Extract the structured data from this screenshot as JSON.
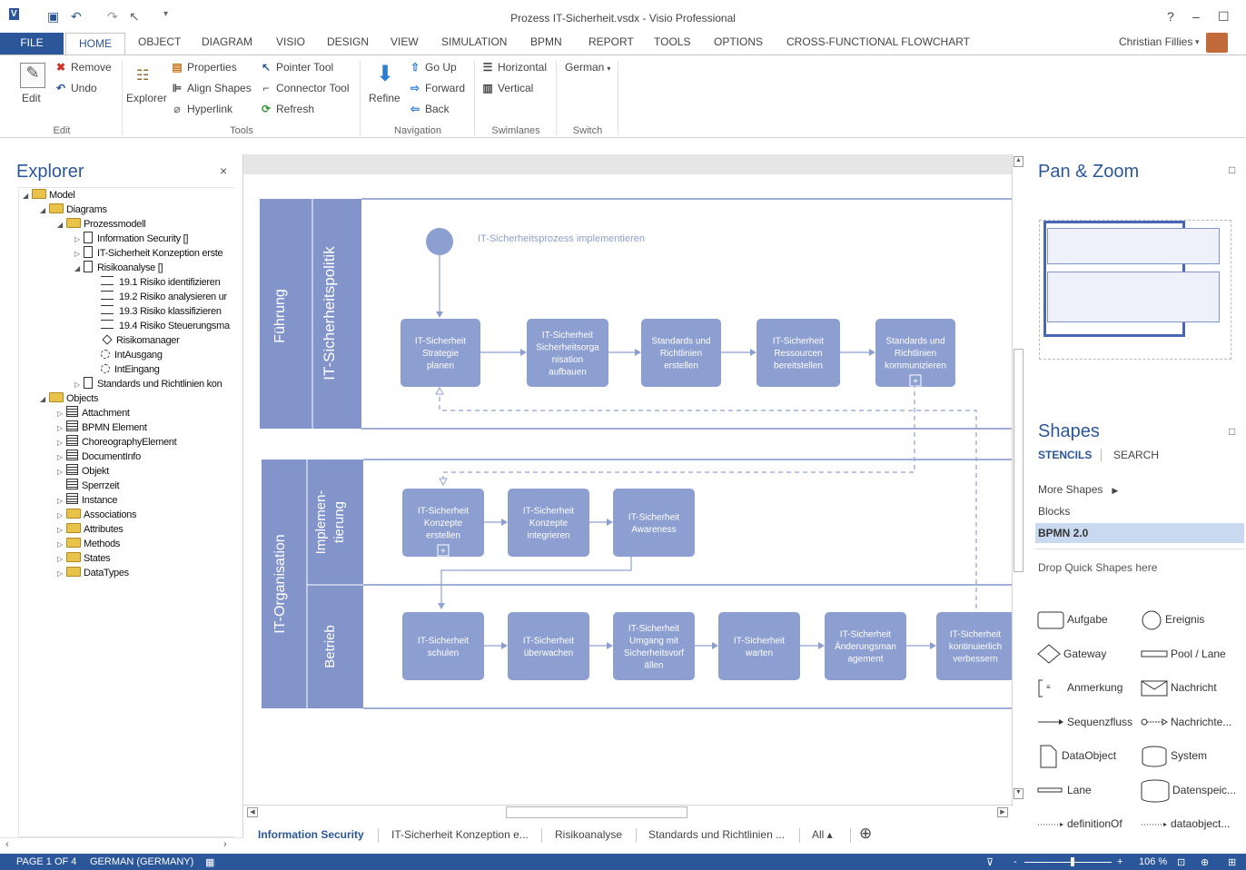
{
  "window": {
    "title": "Prozess IT-Sicherheit.vsdx - Visio Professional",
    "user": "Christian Fillies",
    "help": "?",
    "minimize": "–",
    "restore": "☐"
  },
  "tabs": [
    "FILE",
    "HOME",
    "OBJECT",
    "DIAGRAM",
    "VISIO",
    "DESIGN",
    "VIEW",
    "SIMULATION",
    "BPMN",
    "REPORT",
    "TOOLS",
    "OPTIONS",
    "CROSS-FUNCTIONAL FLOWCHART"
  ],
  "ribbon": {
    "edit": {
      "edit": "Edit",
      "remove": "Remove",
      "undo": "Undo",
      "group": "Edit"
    },
    "tools": {
      "explorer": "Explorer",
      "properties": "Properties",
      "align_shapes": "Align Shapes",
      "hyperlink": "Hyperlink",
      "pointer_tool": "Pointer Tool",
      "connector_tool": "Connector Tool",
      "refresh": "Refresh",
      "group": "Tools"
    },
    "navigation": {
      "refine": "Refine",
      "go_up": "Go Up",
      "forward": "Forward",
      "back": "Back",
      "group": "Navigation"
    },
    "swimlanes": {
      "horizontal": "Horizontal",
      "vertical": "Vertical",
      "group": "Swimlanes"
    },
    "switch": {
      "language": "German",
      "group": "Switch"
    }
  },
  "explorer": {
    "title": "Explorer",
    "close": "×",
    "tree": [
      {
        "label": "Model",
        "level": 0,
        "type": "folder",
        "expanded": true
      },
      {
        "label": "Diagrams",
        "level": 1,
        "type": "folder",
        "expanded": true
      },
      {
        "label": "Prozessmodell",
        "level": 2,
        "type": "folder",
        "expanded": true
      },
      {
        "label": "Information Security []",
        "level": 3,
        "type": "doc",
        "expanded": false
      },
      {
        "label": "IT-Sicherheit Konzeption erste",
        "level": 3,
        "type": "doc",
        "expanded": false
      },
      {
        "label": "Risikoanalyse []",
        "level": 3,
        "type": "doc",
        "expanded": true
      },
      {
        "label": "19.1 Risiko identifizieren",
        "level": 4,
        "type": "lines"
      },
      {
        "label": "19.2 Risiko analysieren ur",
        "level": 4,
        "type": "lines"
      },
      {
        "label": "19.3 Risiko klassifizieren",
        "level": 4,
        "type": "lines"
      },
      {
        "label": "19.4 Risiko Steuerungsma",
        "level": 4,
        "type": "lines"
      },
      {
        "label": "Risikomanager",
        "level": 4,
        "type": "gateway"
      },
      {
        "label": "IntAusgang",
        "level": 4,
        "type": "event"
      },
      {
        "label": "IntEingang",
        "level": 4,
        "type": "event"
      },
      {
        "label": "Standards und Richtlinien kon",
        "level": 3,
        "type": "doc",
        "expanded": false
      },
      {
        "label": "Objects",
        "level": 1,
        "type": "folder",
        "expanded": true
      },
      {
        "label": "Attachment",
        "level": 2,
        "type": "object",
        "expanded": false
      },
      {
        "label": "BPMN Element",
        "level": 2,
        "type": "object",
        "expanded": false
      },
      {
        "label": "ChoreographyElement",
        "level": 2,
        "type": "object",
        "expanded": false
      },
      {
        "label": "DocumentInfo",
        "level": 2,
        "type": "object",
        "expanded": false
      },
      {
        "label": "Objekt",
        "level": 2,
        "type": "object",
        "expanded": false
      },
      {
        "label": "Sperrzeit",
        "level": 2,
        "type": "object"
      },
      {
        "label": "Instance",
        "level": 2,
        "type": "object",
        "expanded": false
      },
      {
        "label": "Associations",
        "level": 2,
        "type": "folder",
        "expanded": false
      },
      {
        "label": "Attributes",
        "level": 2,
        "type": "folder",
        "expanded": false
      },
      {
        "label": "Methods",
        "level": 2,
        "type": "folder",
        "expanded": false
      },
      {
        "label": "States",
        "level": 2,
        "type": "folder",
        "expanded": false
      },
      {
        "label": "DataTypes",
        "level": 2,
        "type": "folder",
        "expanded": false
      }
    ]
  },
  "diagram": {
    "start_event_label": "IT-Sicherheitsprozess implementieren",
    "pools": {
      "p1": "IT-Sicherheitspolitik",
      "p2": "IT-Organisation"
    },
    "lanes": {
      "fuehrung": "Führung",
      "implementierung_1": "Implemen-",
      "implementierung_2": "tierung",
      "betrieb": "Betrieb"
    },
    "tasks": {
      "t1": [
        "IT-Sicherheit",
        "Strategie",
        "planen"
      ],
      "t2": [
        "IT-Sicherheit",
        "Sicherheitsorga",
        "nisation",
        "aufbauen"
      ],
      "t3": [
        "Standards und",
        "Richtlinien",
        "erstellen"
      ],
      "t4": [
        "IT-Sicherheit",
        "Ressourcen",
        "bereitstellen"
      ],
      "t5": [
        "Standards und",
        "Richtlinien",
        "kommunizieren"
      ],
      "t6": [
        "IT-Sicherheit",
        "Konzepte",
        "erstellen"
      ],
      "t7": [
        "IT-Sicherheit",
        "Konzepte",
        "integrieren"
      ],
      "t8": [
        "IT-Sicherheit",
        "Awareness"
      ],
      "t9": [
        "IT-Sicherheit",
        "schulen"
      ],
      "t10": [
        "IT-Sicherheit",
        "überwachen"
      ],
      "t11": [
        "IT-Sicherheit",
        "Umgang mit",
        "Sicherheitsvorf",
        "ällen"
      ],
      "t12": [
        "IT-Sicherheit",
        "warten"
      ],
      "t13": [
        "IT-Sicherheit",
        "Änderungsman",
        "agement"
      ],
      "t14": [
        "IT-Sicherheit",
        "kontinuierlich",
        "verbessern"
      ]
    }
  },
  "page_tabs": {
    "tabs": [
      "Information Security",
      "IT-Sicherheit Konzeption e...",
      "Risikoanalyse",
      "Standards und Richtlinien ..."
    ],
    "all": "All ▴",
    "add": "⊕"
  },
  "pan_zoom": {
    "title": "Pan & Zoom",
    "min": "□"
  },
  "shapes": {
    "title": "Shapes",
    "min": "□",
    "stencils": "STENCILS",
    "search": "SEARCH",
    "more_shapes": "More Shapes",
    "blocks": "Blocks",
    "bpmn": "BPMN 2.0",
    "drop_hint": "Drop Quick Shapes here",
    "items": [
      "Aufgabe",
      "Ereignis",
      "Gateway",
      "Pool / Lane",
      "Anmerkung",
      "Nachricht",
      "Sequenzfluss",
      "Nachrichte...",
      "DataObject",
      "System",
      "Lane",
      "Datenspeic...",
      "definitionOf",
      "dataobject..."
    ]
  },
  "status": {
    "page": "PAGE 1 OF 4",
    "language": "GERMAN (GERMANY)",
    "zoom": "106 %",
    "zoom_level": 0.55
  },
  "colors": {
    "accent": "#2b579a",
    "pool": "#7f93c6",
    "task": "#8d9fd1",
    "lane_text": "#ffffff",
    "dashed": "#8fa2d2"
  }
}
